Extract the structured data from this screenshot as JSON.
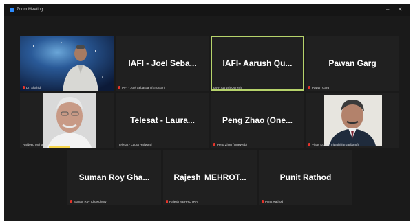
{
  "window": {
    "title": "Zoom Meeting",
    "minimize_glyph": "–",
    "maximize_glyph": "□",
    "close_glyph": "✕"
  },
  "tiles": [
    {
      "display": "",
      "label": "Dr. Shahid"
    },
    {
      "display": "IAFI - Joel Seba...",
      "label": "IAFI - Joel Sebastian (Ericsson)"
    },
    {
      "display": "IAFI- Aarush Qu...",
      "label": "IAFI- Aarush Qureshi"
    },
    {
      "display": "Pawan Garg",
      "label": "Pawan Garg"
    },
    {
      "display": "",
      "label": "Rajdeep Mohanty"
    },
    {
      "display": "Telesat - Laura...",
      "label": "Telesat - Laura Hallward"
    },
    {
      "display": "Peng Zhao (One...",
      "label": "Peng Zhao (OneWeb)"
    },
    {
      "display": "",
      "label": "Vinay Kumar Tripathi (Broadband)"
    },
    {
      "display": "Suman Roy Gha...",
      "label": "Suman Roy Chowdhury"
    },
    {
      "display": "Rajesh  MEHROT...",
      "label": "Rajesh MEHROTRA"
    },
    {
      "display": "Punit Rathod",
      "label": "Punit Rathod"
    }
  ]
}
